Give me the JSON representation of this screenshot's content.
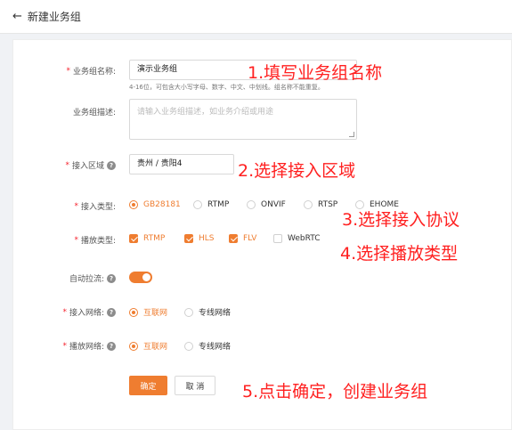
{
  "header": {
    "back_icon": "←",
    "title": "新建业务组"
  },
  "form": {
    "name": {
      "label": "业务组名称:",
      "value": "演示业务组",
      "hint": "4-16位，可包含大小写字母、数字、中文、中划线。组名称不能重复。"
    },
    "desc": {
      "label": "业务组描述:",
      "placeholder": "请输入业务组描述，如业务介绍或用途"
    },
    "region": {
      "label": "接入区域",
      "value": "贵州 / 贵阳4"
    },
    "protocol": {
      "label": "接入类型:",
      "options": [
        "GB28181",
        "RTMP",
        "ONVIF",
        "RTSP",
        "EHOME"
      ],
      "selected": "GB28181"
    },
    "play_type": {
      "label": "播放类型:",
      "options": [
        "RTMP",
        "HLS",
        "FLV",
        "WebRTC"
      ],
      "checked": [
        "RTMP",
        "HLS",
        "FLV"
      ]
    },
    "auto_pull": {
      "label": "自动拉流:",
      "on": true
    },
    "access_net": {
      "label": "接入网络:",
      "options": [
        "互联网",
        "专线网络"
      ],
      "selected": "互联网"
    },
    "play_net": {
      "label": "播放网络:",
      "options": [
        "互联网",
        "专线网络"
      ],
      "selected": "互联网"
    },
    "confirm_label": "确定",
    "cancel_label": "取 消"
  },
  "annotations": {
    "step1": "1.填写业务组名称",
    "step2": "2.选择接入区域",
    "step3": "3.选择接入协议",
    "step4": "4.选择播放类型",
    "step5": "5.点击确定，创建业务组"
  },
  "colors": {
    "accent": "#ef7d30",
    "required": "#f5222d",
    "annotation": "#ff2020"
  }
}
